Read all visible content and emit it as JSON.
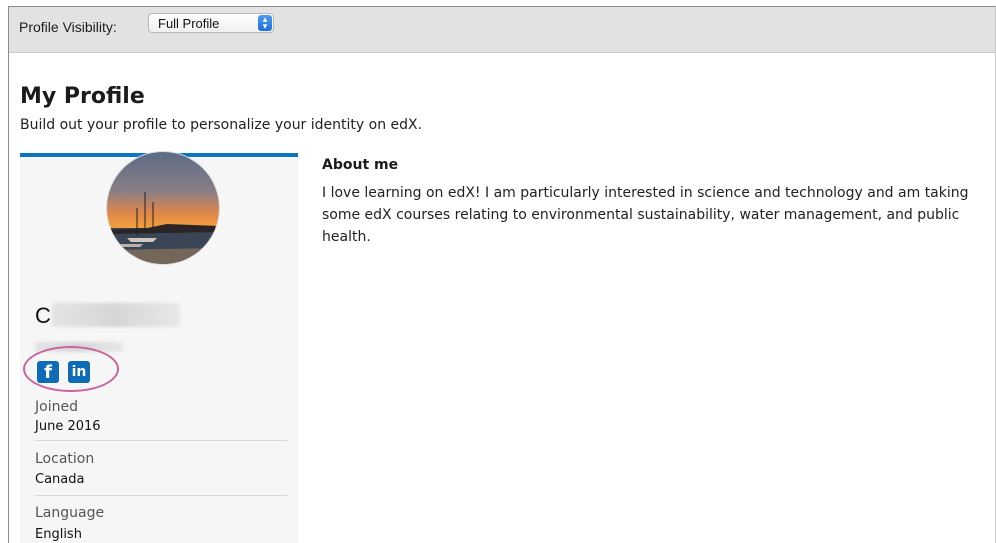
{
  "visibility": {
    "label": "Profile Visibility:",
    "selected": "Full Profile"
  },
  "page": {
    "title": "My Profile",
    "subtitle": "Build out your profile to personalize your identity on edX."
  },
  "profile": {
    "name_initial": "C",
    "social": [
      {
        "icon": "facebook-icon",
        "glyph": "f"
      },
      {
        "icon": "linkedin-icon",
        "glyph": "in"
      }
    ],
    "fields": [
      {
        "label": "Joined",
        "value": "June 2016"
      },
      {
        "label": "Location",
        "value": "Canada"
      },
      {
        "label": "Language",
        "value": "English"
      }
    ]
  },
  "about": {
    "title": "About me",
    "text": "I love learning on edX! I am particularly interested in science and technology and am taking some edX courses relating to environmental sustainability, water management, and public health."
  },
  "colors": {
    "accent": "#0a75c2",
    "highlight": "#c9649d",
    "social": "#0e6bb7"
  }
}
